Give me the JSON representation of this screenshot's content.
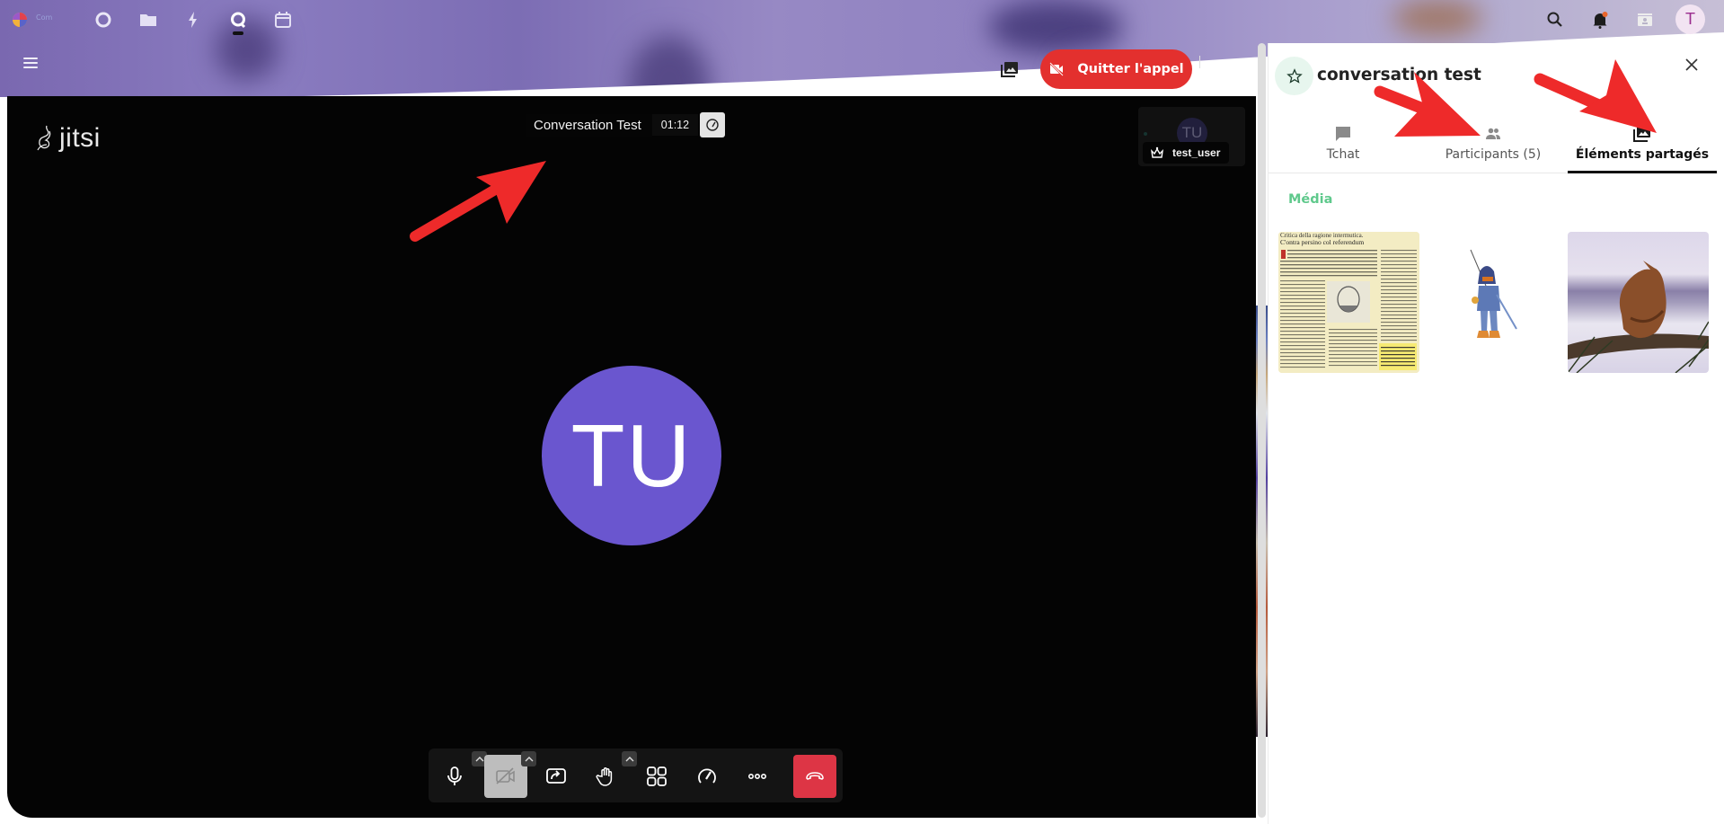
{
  "app": {
    "logo_text": "Com",
    "nav": [
      {
        "name": "dashboard",
        "icon": "circle-icon"
      },
      {
        "name": "files",
        "icon": "folder-icon"
      },
      {
        "name": "activity",
        "icon": "lightning-icon"
      },
      {
        "name": "talk",
        "icon": "talk-icon",
        "active": true
      },
      {
        "name": "calendar",
        "icon": "calendar-icon"
      }
    ],
    "right_icons": [
      "search-icon",
      "bell-icon",
      "contacts-icon"
    ],
    "user_initial": "T",
    "notification_dot_color": "#e9652b"
  },
  "call_header": {
    "media_button_icon": "shared-media-icon",
    "leave_label": "Quitter l'appel",
    "leave_color": "#e3302e"
  },
  "video": {
    "logo_text": "jitsi",
    "conference_name": "Conversation Test",
    "timer": "01:12",
    "thumbnail": {
      "initials": "TU",
      "username": "test_user",
      "badge_icon": "moderator-crown-icon"
    },
    "main_avatar": {
      "initials": "TU",
      "color": "#6a56cf"
    },
    "toolbar": [
      {
        "name": "microphone",
        "icon": "microphone-icon",
        "has_caret": true
      },
      {
        "name": "camera",
        "icon": "camera-off-icon",
        "has_caret": true,
        "state": "off"
      },
      {
        "name": "share-screen",
        "icon": "screen-share-icon",
        "has_caret": false
      },
      {
        "name": "raise-hand",
        "icon": "hand-icon",
        "has_caret": true
      },
      {
        "name": "tile-view",
        "icon": "grid-icon",
        "has_caret": false
      },
      {
        "name": "performance",
        "icon": "gauge-icon",
        "has_caret": false
      },
      {
        "name": "more",
        "icon": "more-icon",
        "has_caret": false
      },
      {
        "name": "hangup",
        "icon": "hangup-icon",
        "has_caret": false
      }
    ]
  },
  "panel": {
    "title": "conversation test",
    "tabs": [
      {
        "label": "Tchat",
        "icon": "chat-icon",
        "active": false
      },
      {
        "label": "Participants (5)",
        "icon": "participants-icon",
        "active": false
      },
      {
        "label": "Éléments partagés",
        "icon": "shared-media-icon",
        "active": true
      }
    ],
    "section_title": "Média",
    "media": [
      {
        "name": "newspaper-clipping",
        "caption_lines": [
          "Critica della ragione intermutica.",
          "C'ontra persino col referendum"
        ]
      },
      {
        "name": "anime-warrior-drawing"
      },
      {
        "name": "bird-on-branch-photo"
      }
    ]
  },
  "annotations": {
    "arrow_color": "#ee2a2a",
    "count": 3
  }
}
